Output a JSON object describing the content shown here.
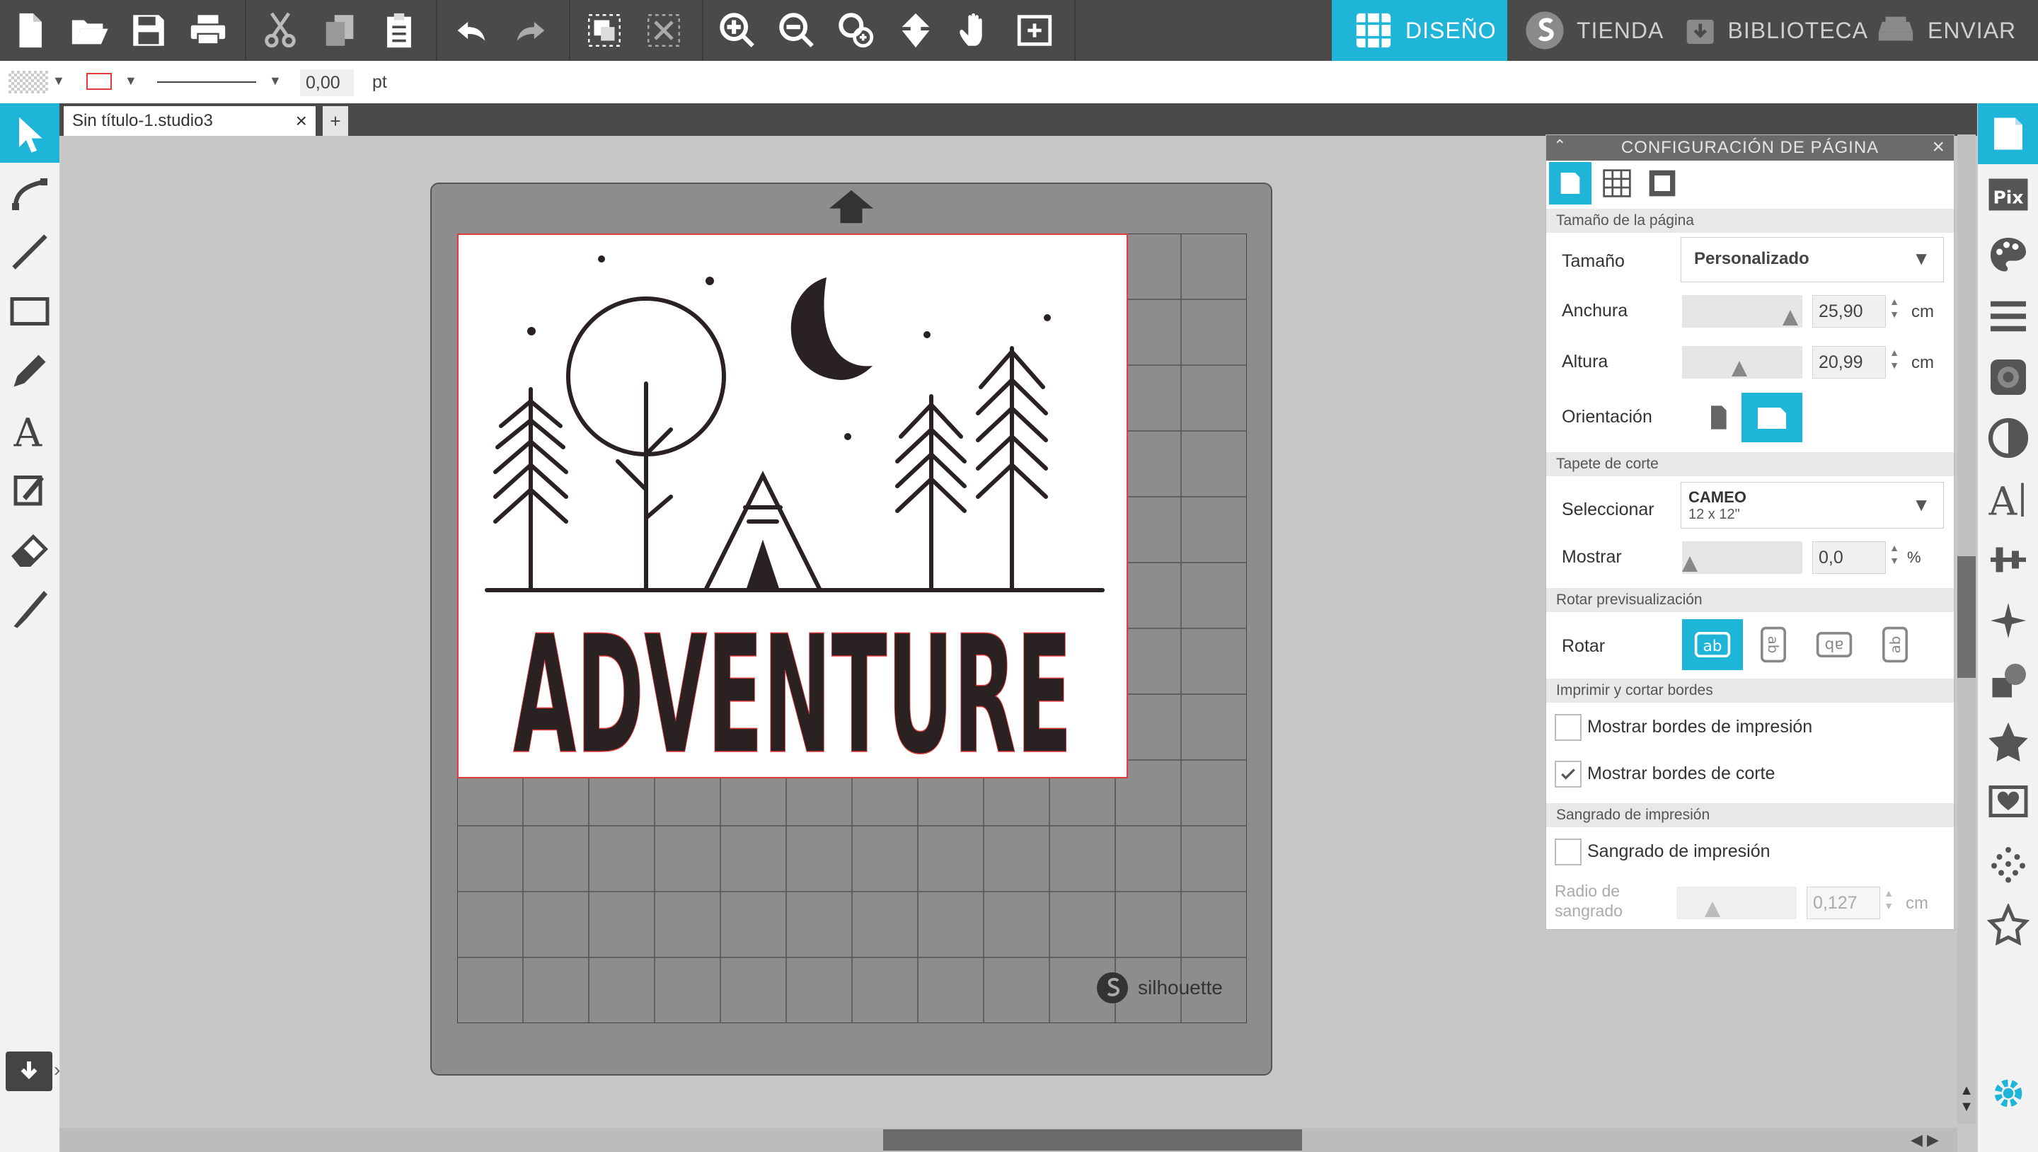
{
  "nav": {
    "design": "DISEÑO",
    "store": "TIENDA",
    "library": "BIBLIOTECA",
    "send": "ENVIAR",
    "active_color": "#1fb5d8"
  },
  "optbar": {
    "line_width": "0,00",
    "line_unit": "pt"
  },
  "document": {
    "tab_title": "Sin título-1.studio3",
    "close": "×",
    "add": "+"
  },
  "mat": {
    "brand": "silhouette"
  },
  "panel": {
    "title": "CONFIGURACIÓN DE PÁGINA",
    "close": "×",
    "sections": {
      "page_size": "Tamaño de la página",
      "cut_mat": "Tapete de corte",
      "rotate_preview": "Rotar previsualización",
      "print_cut_borders": "Imprimir y cortar bordes",
      "print_bleed": "Sangrado de impresión"
    },
    "size_label": "Tamaño",
    "size_value": "Personalizado",
    "width_label": "Anchura",
    "width_value": "25,90",
    "width_unit": "cm",
    "height_label": "Altura",
    "height_value": "20,99",
    "height_unit": "cm",
    "orientation_label": "Orientación",
    "select_mat_label": "Seleccionar tapete de",
    "mat_name": "CAMEO",
    "mat_size": "12 x 12\"",
    "show_label": "Mostrar",
    "show_value": "0,0",
    "show_unit": "%",
    "rotate_label": "Rotar",
    "show_print_borders": "Mostrar bordes de impresión",
    "show_cut_borders": "Mostrar bordes de corte",
    "bleed_checkbox": "Sangrado de impresión",
    "bleed_radius_label": "Radio de sangrado",
    "bleed_radius_value": "0,127",
    "bleed_radius_unit": "cm"
  },
  "artwork": {
    "word": "ADVENTURE"
  }
}
